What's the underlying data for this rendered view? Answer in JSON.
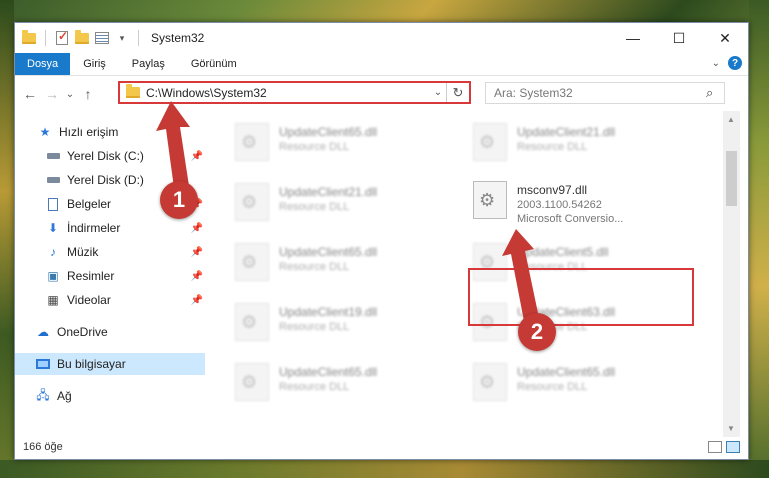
{
  "window": {
    "title": "System32",
    "minimize_glyph": "—",
    "maximize_glyph": "☐",
    "close_glyph": "✕"
  },
  "ribbon": {
    "tabs": [
      "Dosya",
      "Giriş",
      "Paylaş",
      "Görünüm"
    ],
    "help_label": "?"
  },
  "address": {
    "path": "C:\\Windows\\System32",
    "back_glyph": "←",
    "forward_glyph": "→",
    "recent_glyph": "⌄",
    "up_glyph": "↑",
    "refresh_glyph": "↻",
    "dropdown_glyph": "⌄"
  },
  "search": {
    "placeholder": "Ara: System32",
    "icon_glyph": "⌕"
  },
  "sidebar": {
    "items": [
      {
        "label": "Hızlı erişim",
        "icon": "star-icon"
      },
      {
        "label": "Yerel Disk (C:)",
        "icon": "drive-icon"
      },
      {
        "label": "Yerel Disk (D:)",
        "icon": "drive-icon"
      },
      {
        "label": "Belgeler",
        "icon": "document-icon"
      },
      {
        "label": "İndirmeler",
        "icon": "download-icon"
      },
      {
        "label": "Müzik",
        "icon": "music-icon"
      },
      {
        "label": "Resimler",
        "icon": "pictures-icon"
      },
      {
        "label": "Videolar",
        "icon": "video-icon"
      },
      {
        "label": "OneDrive",
        "icon": "cloud-icon"
      },
      {
        "label": "Bu bilgisayar",
        "icon": "computer-icon"
      },
      {
        "label": "Ağ",
        "icon": "network-icon"
      }
    ]
  },
  "files": [
    {
      "name": "UpdateClient65.dll",
      "desc": "Resource DLL"
    },
    {
      "name": "UpdateClient21.dll",
      "desc": "Resource DLL"
    },
    {
      "name": "UpdateClient21.dll",
      "desc": "Resource DLL"
    },
    {
      "name": "msconv97.dll",
      "version": "2003.1100.54262",
      "desc": "Microsoft Conversio..."
    },
    {
      "name": "UpdateClient65.dll",
      "desc": "Resource DLL"
    },
    {
      "name": "UpdateClient5.dll",
      "desc": "Resource DLL"
    },
    {
      "name": "UpdateClient19.dll",
      "desc": "Resource DLL"
    },
    {
      "name": "UpdateClient63.dll",
      "desc": "Resource DLL"
    },
    {
      "name": "UpdateClient65.dll",
      "desc": "Resource DLL"
    },
    {
      "name": "UpdateClient65.dll",
      "desc": "Resource DLL"
    }
  ],
  "status": {
    "count_text": "166 öğe"
  },
  "annotations": {
    "step1": "1",
    "step2": "2",
    "color": "#c53a34"
  }
}
